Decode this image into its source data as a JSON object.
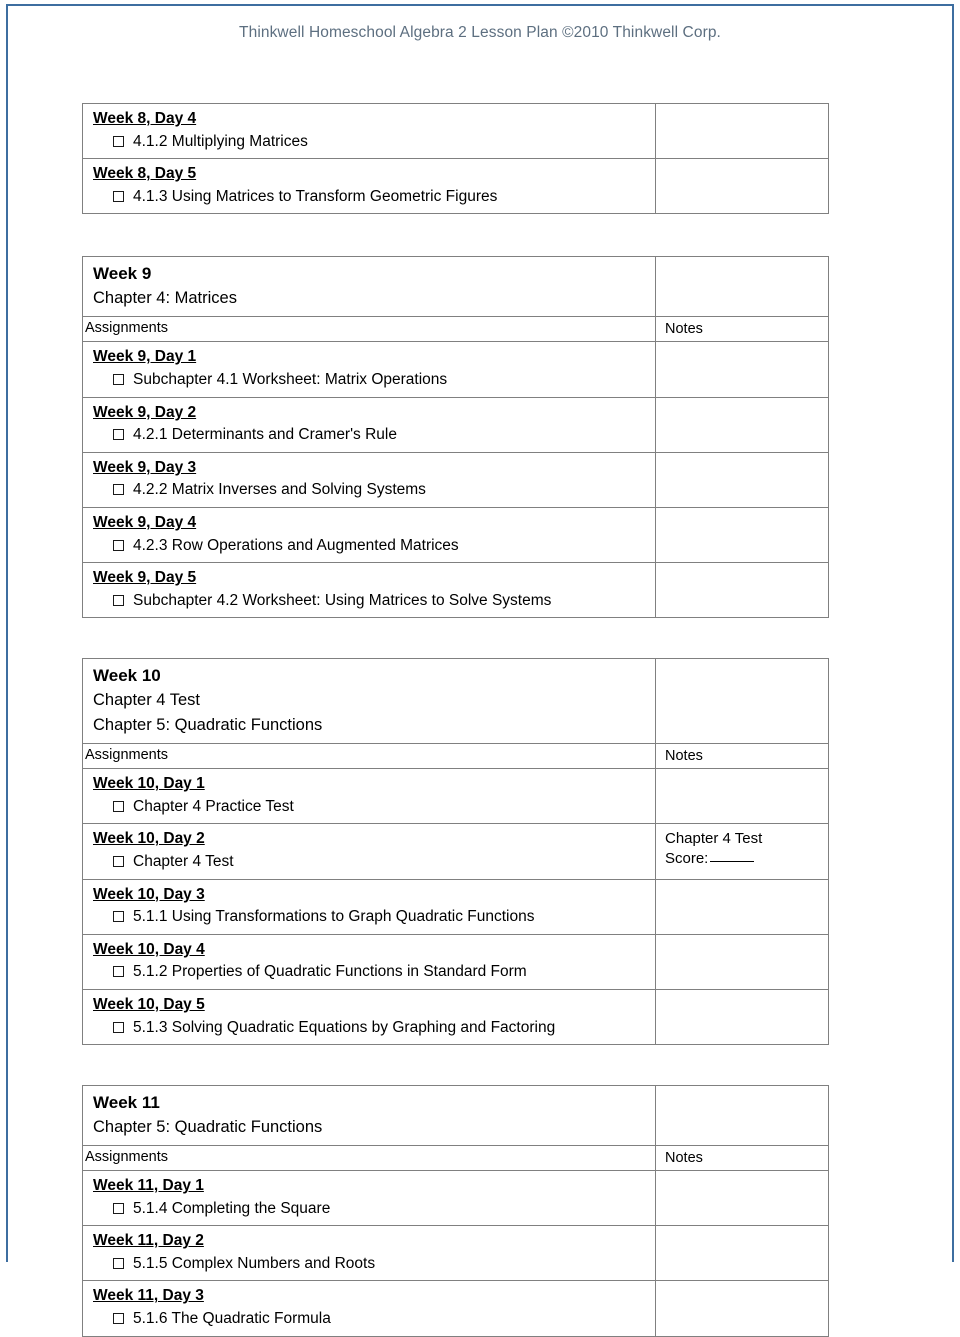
{
  "header": {
    "text": "Thinkwell Homeschool Algebra 2 Lesson Plan ©2010 Thinkwell Corp.",
    "color": "#5d6f80"
  },
  "labels": {
    "assignments": "Assignments",
    "notes": "Notes",
    "checkbox_icon": "checkbox-unchecked"
  },
  "tables": [
    {
      "id": "week-8-continued",
      "has_title_block": false,
      "rows": [
        {
          "day": "Week 8, Day 4",
          "task": "4.1.2 Multiplying Matrices",
          "note": ""
        },
        {
          "day": "Week 8, Day 5",
          "task": "4.1.3 Using Matrices to Transform Geometric Figures",
          "note": ""
        }
      ]
    },
    {
      "id": "week-9",
      "has_title_block": true,
      "title": "Week 9",
      "subtitles": [
        "Chapter 4: Matrices"
      ],
      "rows": [
        {
          "day": "Week 9, Day 1",
          "task": "Subchapter 4.1 Worksheet: Matrix Operations",
          "note": ""
        },
        {
          "day": "Week 9, Day 2",
          "task": "4.2.1 Determinants and Cramer's Rule",
          "note": ""
        },
        {
          "day": "Week 9, Day 3",
          "task": "4.2.2 Matrix Inverses and Solving Systems",
          "note": ""
        },
        {
          "day": "Week 9, Day 4",
          "task": "4.2.3 Row Operations and Augmented Matrices",
          "note": ""
        },
        {
          "day": "Week 9, Day 5",
          "task": "Subchapter 4.2 Worksheet: Using Matrices to Solve Systems",
          "note": ""
        }
      ]
    },
    {
      "id": "week-10",
      "has_title_block": true,
      "title": "Week 10",
      "subtitles": [
        "Chapter 4 Test",
        "Chapter 5: Quadratic Functions"
      ],
      "rows": [
        {
          "day": "Week 10, Day 1",
          "task": "Chapter 4 Practice Test",
          "note": ""
        },
        {
          "day": "Week 10, Day 2",
          "task": "Chapter 4 Test",
          "note": "Chapter 4 Test",
          "note_line2": "Score:",
          "note_blank": true
        },
        {
          "day": "Week 10, Day 3",
          "task": "5.1.1 Using Transformations to Graph Quadratic Functions",
          "note": ""
        },
        {
          "day": "Week 10, Day 4",
          "task": "5.1.2 Properties of Quadratic Functions in Standard Form",
          "note": ""
        },
        {
          "day": "Week 10, Day 5",
          "task": "5.1.3 Solving Quadratic Equations by Graphing and Factoring",
          "note": ""
        }
      ]
    },
    {
      "id": "week-11",
      "has_title_block": true,
      "title": "Week 11",
      "subtitles": [
        "Chapter 5: Quadratic Functions"
      ],
      "rows": [
        {
          "day": "Week 11, Day 1",
          "task": "5.1.4 Completing the Square",
          "note": ""
        },
        {
          "day": "Week 11, Day 2",
          "task": "5.1.5 Complex Numbers and Roots",
          "note": ""
        },
        {
          "day": "Week 11, Day 3",
          "task": "5.1.6 The Quadratic Formula",
          "note": ""
        }
      ]
    }
  ]
}
